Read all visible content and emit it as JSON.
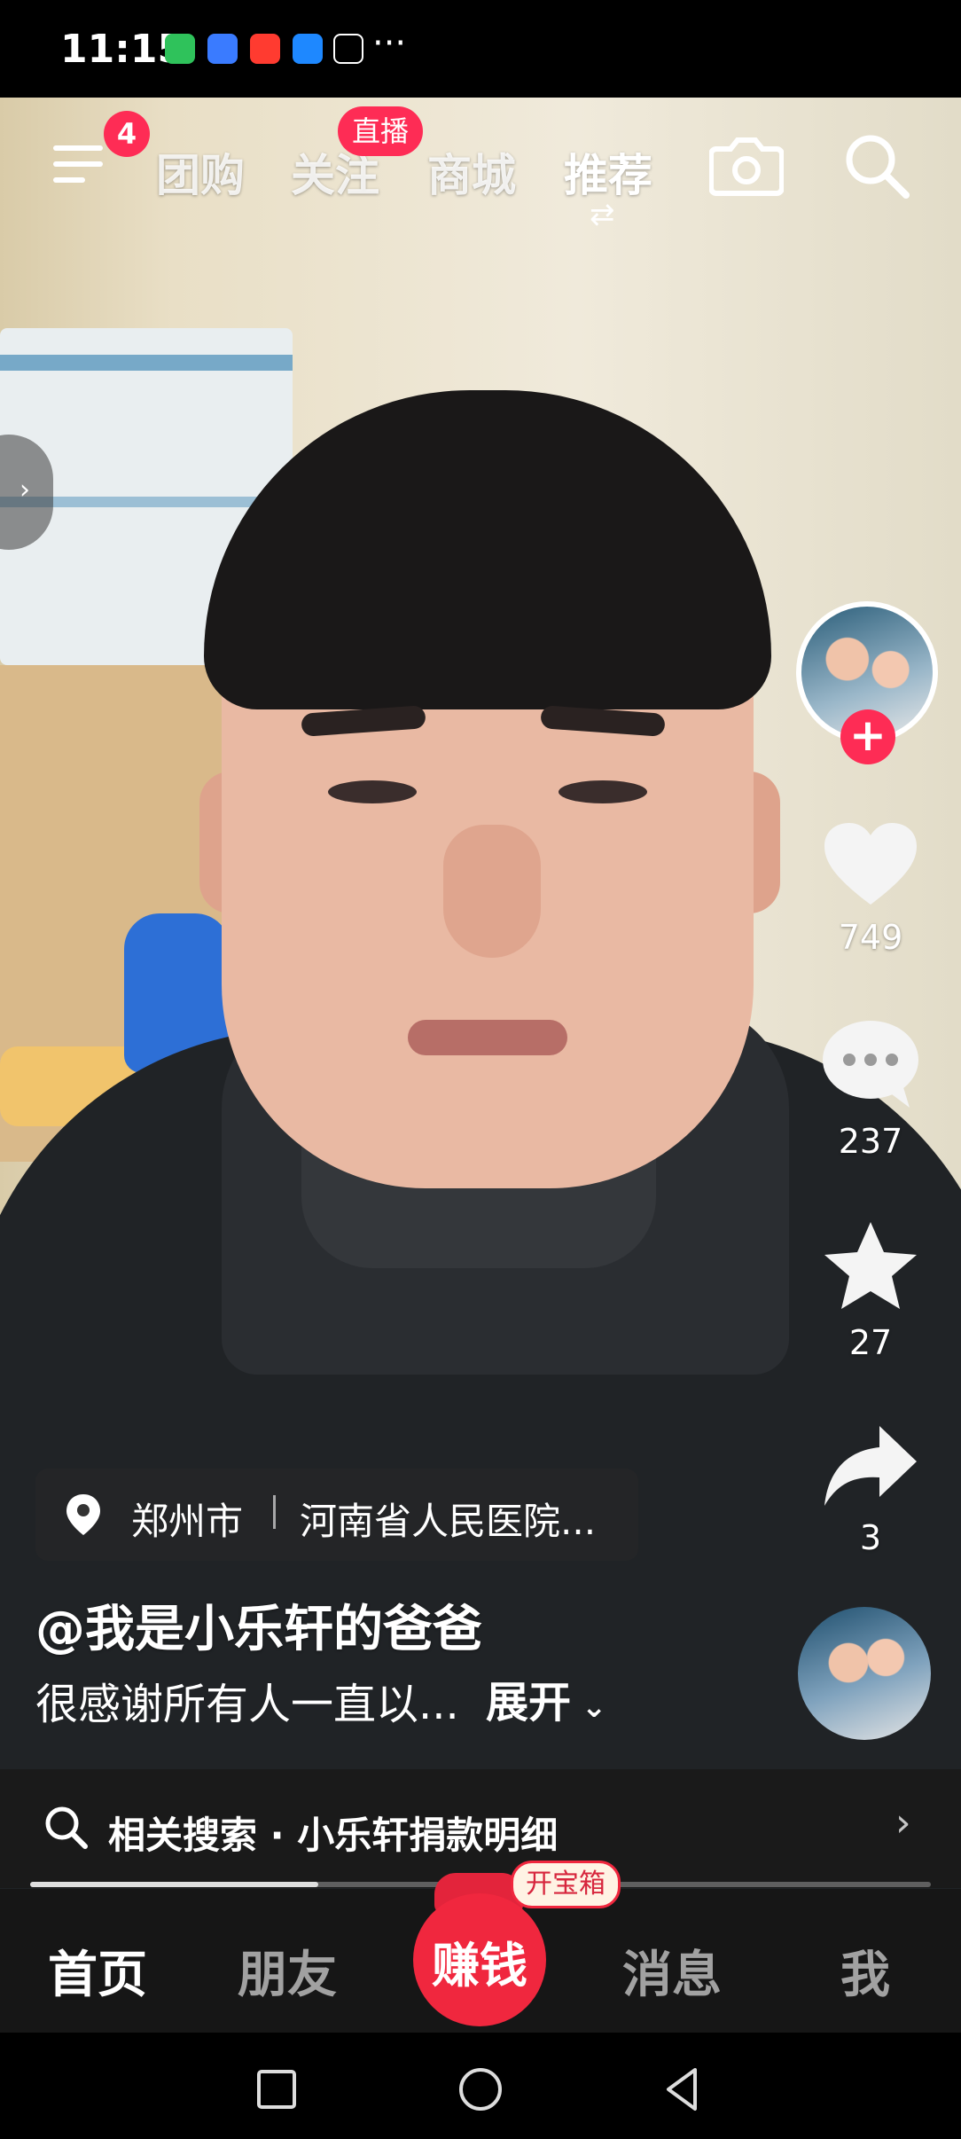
{
  "status_bar": {
    "time": "11:15",
    "app_icons": [
      "wechat-icon",
      "calendar-icon",
      "app-icon-red",
      "bulb-icon",
      "capcut-icon"
    ],
    "more": "···",
    "colors": {
      "wechat": "#2fc25b",
      "calendar": "#3a7bff",
      "red_app": "#ff3b30",
      "bulb": "#1e88ff"
    }
  },
  "top_nav": {
    "menu_badge": "4",
    "tabs": [
      {
        "label": "团购",
        "active": false
      },
      {
        "label": "关注",
        "active": false,
        "badge": "直播"
      },
      {
        "label": "商城",
        "active": false
      },
      {
        "label": "推荐",
        "active": true
      }
    ],
    "active_indicator": "⇄",
    "icons": [
      "camera-icon",
      "search-icon"
    ]
  },
  "sidebar": {
    "likes": "749",
    "comments": "237",
    "favorites": "27",
    "shares": "3",
    "accent": "#fe2c55"
  },
  "location": {
    "city": "郑州市",
    "place": "河南省人民医院..."
  },
  "post": {
    "author": "@我是小乐轩的爸爸",
    "description": "很感谢所有人一直以...",
    "expand_label": "展开"
  },
  "related_search": {
    "text": "相关搜索 · 小乐轩捐款明细"
  },
  "progress": {
    "fraction": 0.32
  },
  "bottom_nav": {
    "tabs": [
      {
        "label": "首页",
        "active": true
      },
      {
        "label": "朋友",
        "active": false
      },
      {
        "label": "消息",
        "active": false
      },
      {
        "label": "我",
        "active": false
      }
    ],
    "earn_label": "赚钱",
    "treasure_badge": "开宝箱",
    "earn_color": "#f0273e"
  },
  "system_nav": [
    "recent-apps-button",
    "home-button",
    "back-button"
  ]
}
